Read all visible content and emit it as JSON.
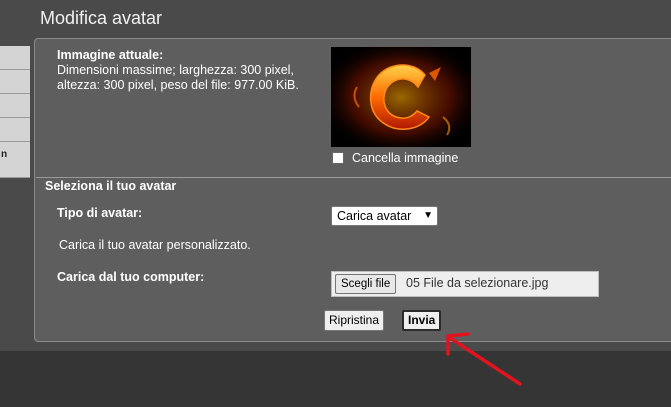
{
  "header": {
    "title": "Modifica avatar"
  },
  "sidebar": {
    "items": [
      {
        "label": ""
      },
      {
        "label": ""
      },
      {
        "label": ""
      },
      {
        "label": ""
      },
      {
        "label": "n"
      }
    ]
  },
  "current_image": {
    "label": "Immagine attuale:",
    "description": "Dimensioni massime; larghezza: 300 pixel, altezza: 300 pixel, peso del file: 977.00 KiB.",
    "delete_label": "Cancella immagine",
    "logo_colors": [
      "#ff6a00",
      "#ffb000",
      "#c02000"
    ]
  },
  "select_section": {
    "title": "Seleziona il tuo avatar",
    "type_label": "Tipo di avatar:",
    "type_value": "Carica avatar",
    "hint": "Carica il tuo avatar personalizzato.",
    "upload_label": "Carica dal tuo computer:",
    "file_button": "Scegli file",
    "file_name": "05 File da selezionare.jpg"
  },
  "actions": {
    "reset_label": "Ripristina",
    "submit_label": "Invia"
  },
  "annotation": {
    "arrow_color": "#e0141e"
  }
}
